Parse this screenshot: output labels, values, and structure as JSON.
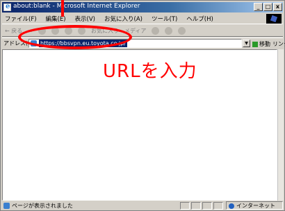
{
  "window": {
    "title": "about:blank - Microsoft Internet Explorer",
    "minimize_label": "_",
    "maximize_label": "□",
    "close_label": "x"
  },
  "menu": {
    "items": [
      "ファイル(F)",
      "編集(E)",
      "表示(V)",
      "お気に入り(A)",
      "ツール(T)",
      "ヘルプ(H)"
    ]
  },
  "toolbar": {
    "back": "← 戻る",
    "forward": "→",
    "favorites": "お気に入り",
    "media": "メディア"
  },
  "address": {
    "label": "アドレス(D)",
    "url": "https://bbsvpn.eu.toyota.co.jp/",
    "go": "移動",
    "links": "リンク »"
  },
  "status": {
    "text": "ページが表示されました",
    "zone": "インターネット"
  },
  "annotation": {
    "callout": "URLを入力",
    "color": "#ff0000"
  }
}
